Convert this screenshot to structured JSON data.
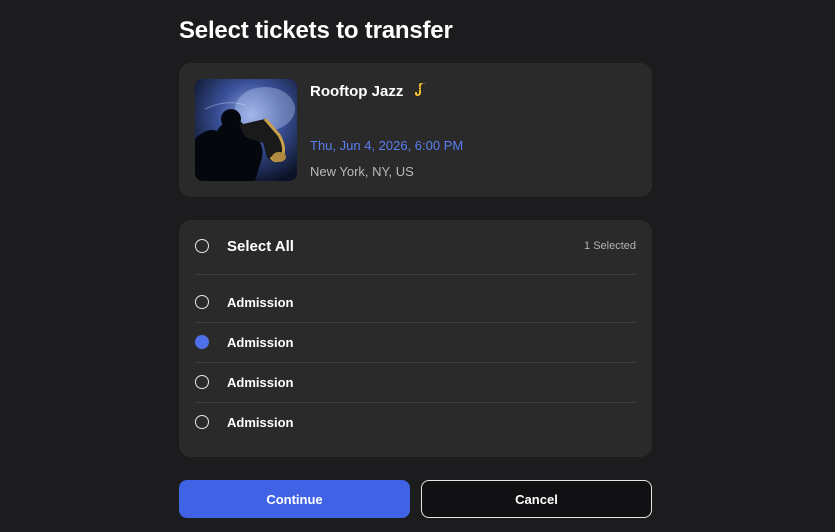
{
  "page": {
    "title": "Select tickets to transfer"
  },
  "event": {
    "name": "Rooftop Jazz",
    "name_icon": "saxophone-icon",
    "date": "Thu, Jun 4, 2026, 6:00 PM",
    "location": "New York, NY, US",
    "image_icon": "saxophone-player-photo"
  },
  "tickets": {
    "select_all_label": "Select All",
    "selected_count": "1 Selected",
    "items": [
      {
        "label": "Admission",
        "selected": false
      },
      {
        "label": "Admission",
        "selected": true
      },
      {
        "label": "Admission",
        "selected": false
      },
      {
        "label": "Admission",
        "selected": false
      }
    ]
  },
  "actions": {
    "continue_label": "Continue",
    "cancel_label": "Cancel"
  },
  "colors": {
    "background": "#1c1c1f",
    "card": "#2a2a2a",
    "accent": "#3f63e4",
    "date_text": "#5b7ef0"
  }
}
